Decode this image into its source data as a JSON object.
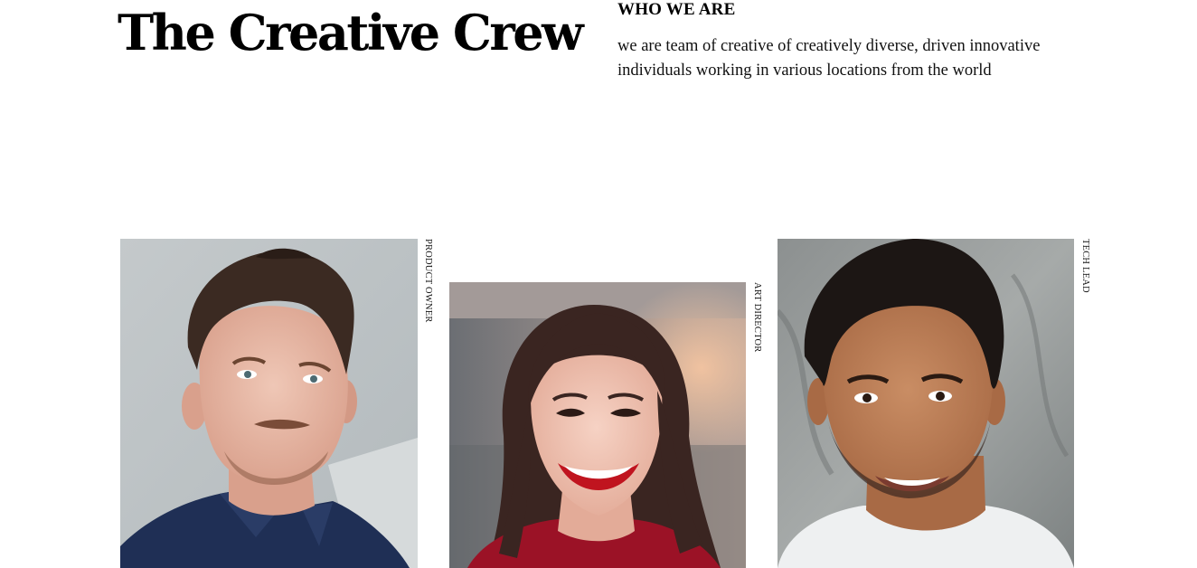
{
  "header": {
    "title": "The Creative Crew"
  },
  "about": {
    "heading": "WHO WE ARE",
    "text": "we are team of creative of creatively diverse, driven innovative individuals working in various locations from the world"
  },
  "team": [
    {
      "role": "PRODUCT OWNER"
    },
    {
      "role": "ART DIRECTOR"
    },
    {
      "role": "TECH LEAD"
    }
  ]
}
